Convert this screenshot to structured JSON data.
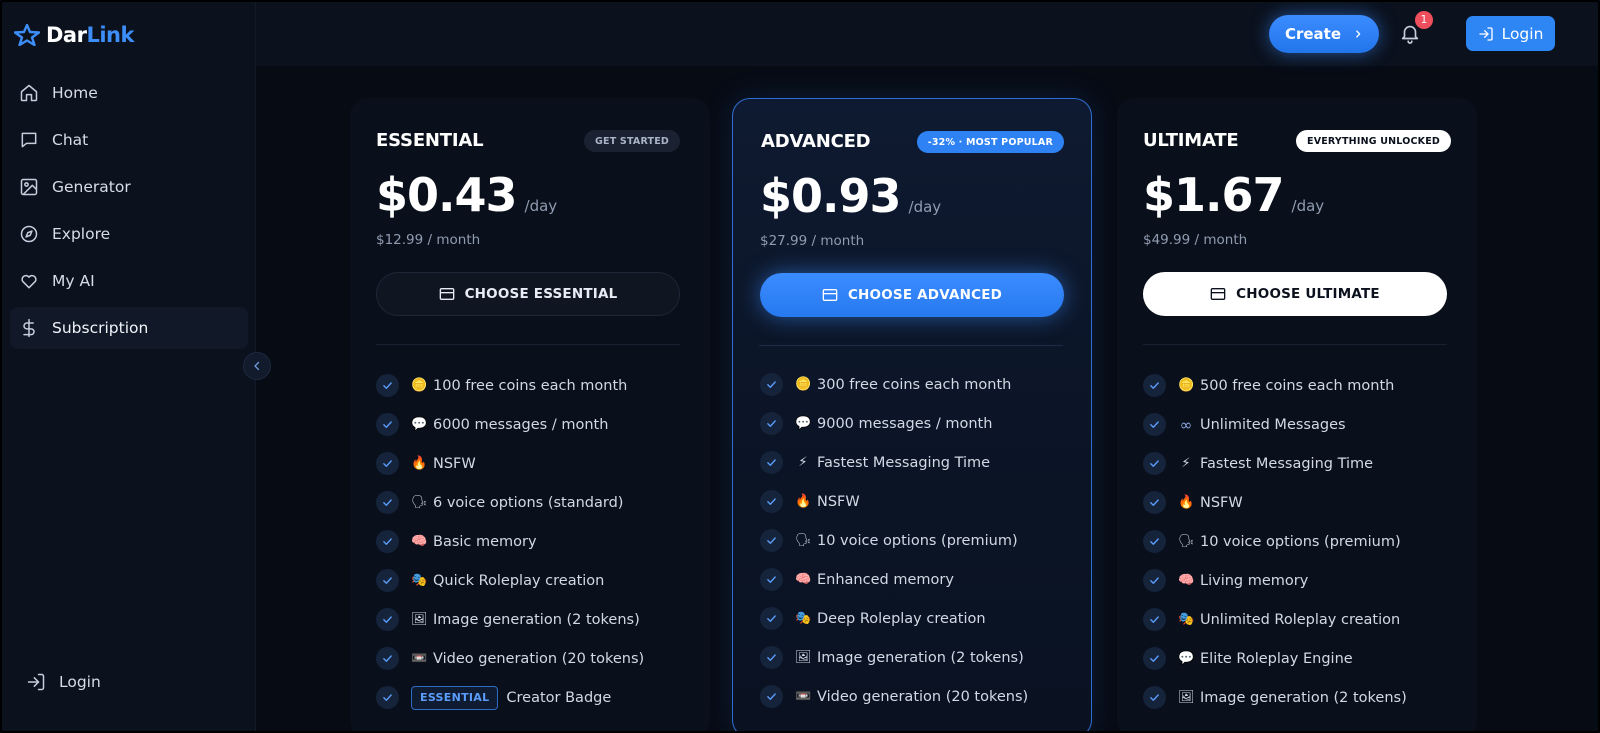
{
  "brand": {
    "name_part1": "Dar",
    "name_part2": "Link"
  },
  "nav": {
    "items": [
      {
        "label": "Home",
        "icon": "home-icon"
      },
      {
        "label": "Chat",
        "icon": "chat-icon"
      },
      {
        "label": "Generator",
        "icon": "image-icon"
      },
      {
        "label": "Explore",
        "icon": "compass-icon"
      },
      {
        "label": "My AI",
        "icon": "heart-icon"
      },
      {
        "label": "Subscription",
        "icon": "dollar-icon",
        "active": true
      }
    ],
    "login_label": "Login"
  },
  "topbar": {
    "create_label": "Create",
    "notification_count": "1",
    "login_label": "Login"
  },
  "colors": {
    "accent": "#2e86f5",
    "background": "#070b14",
    "badge_red": "#ef4f5c"
  },
  "plans": [
    {
      "name": "ESSENTIAL",
      "badge": "GET STARTED",
      "price": "$0.43",
      "per": "/day",
      "monthly": "$12.99 / month",
      "cta": "CHOOSE ESSENTIAL",
      "features": [
        {
          "emoji": "🪙",
          "text": "100 free coins each month"
        },
        {
          "emoji": "💬",
          "text": "6000 messages / month"
        },
        {
          "emoji": "🔥",
          "text": "NSFW"
        },
        {
          "emoji": "🗣",
          "text": "6 voice options (standard)"
        },
        {
          "emoji": "🧠",
          "text": "Basic memory"
        },
        {
          "emoji": "🎭",
          "text": "Quick Roleplay creation"
        },
        {
          "emoji": "🖼",
          "text": "Image generation (2 tokens)"
        },
        {
          "emoji": "📼",
          "text": "Video generation (20 tokens)"
        },
        {
          "chip": "ESSENTIAL",
          "text": "Creator Badge"
        }
      ]
    },
    {
      "name": "ADVANCED",
      "badge": "-32% · MOST POPULAR",
      "price": "$0.93",
      "per": "/day",
      "monthly": "$27.99 / month",
      "cta": "CHOOSE ADVANCED",
      "features": [
        {
          "emoji": "🪙",
          "text": "300 free coins each month"
        },
        {
          "emoji": "💬",
          "text": "9000 messages / month"
        },
        {
          "emoji": "⚡",
          "text": "Fastest Messaging Time"
        },
        {
          "emoji": "🔥",
          "text": "NSFW"
        },
        {
          "emoji": "🗣",
          "text": "10 voice options (premium)"
        },
        {
          "emoji": "🧠",
          "text": "Enhanced memory"
        },
        {
          "emoji": "🎭",
          "text": "Deep Roleplay creation"
        },
        {
          "emoji": "🖼",
          "text": "Image generation (2 tokens)"
        },
        {
          "emoji": "📼",
          "text": "Video generation (20 tokens)"
        }
      ]
    },
    {
      "name": "ULTIMATE",
      "badge": "EVERYTHING UNLOCKED",
      "price": "$1.67",
      "per": "/day",
      "monthly": "$49.99 / month",
      "cta": "CHOOSE ULTIMATE",
      "features": [
        {
          "emoji": "🪙",
          "text": "500 free coins each month"
        },
        {
          "emoji": "∞",
          "text": "Unlimited Messages"
        },
        {
          "emoji": "⚡",
          "text": "Fastest Messaging Time"
        },
        {
          "emoji": "🔥",
          "text": "NSFW"
        },
        {
          "emoji": "🗣",
          "text": "10 voice options (premium)"
        },
        {
          "emoji": "🧠",
          "text": "Living memory"
        },
        {
          "emoji": "🎭",
          "text": "Unlimited Roleplay creation"
        },
        {
          "emoji": "💬",
          "text": "Elite Roleplay Engine"
        },
        {
          "emoji": "🖼",
          "text": "Image generation (2 tokens)"
        }
      ]
    }
  ]
}
